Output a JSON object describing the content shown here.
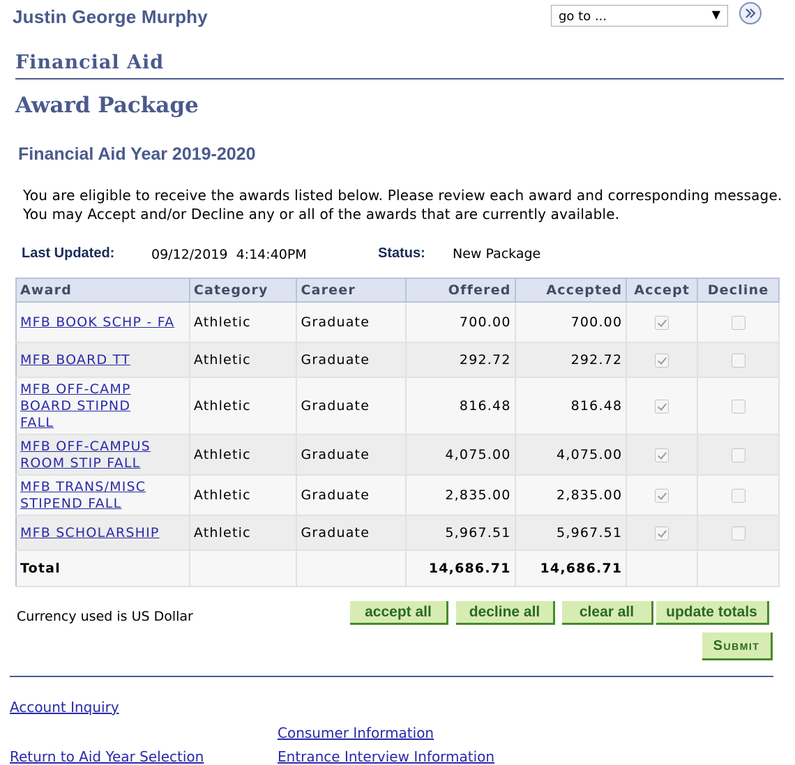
{
  "header": {
    "student_name": "Justin George Murphy",
    "goto": {
      "selected": "go to ..."
    }
  },
  "section_title": "Financial Aid",
  "page_title": "Award Package",
  "aid_year_heading": "Financial Aid Year 2019-2020",
  "intro": "You are eligible to receive the awards listed below. Please review each award and corresponding message. You may Accept and/or Decline any or all of the awards that are currently available.",
  "meta": {
    "last_updated_label": "Last Updated:",
    "last_updated_value": "09/12/2019  4:14:40PM",
    "status_label": "Status:",
    "status_value": "New Package"
  },
  "table": {
    "headers": [
      "Award",
      "Category",
      "Career",
      "Offered",
      "Accepted",
      "Accept",
      "Decline"
    ],
    "rows": [
      {
        "award": "MFB BOOK SCHP - FA",
        "category": "Athletic",
        "career": "Graduate",
        "offered": "700.00",
        "accepted": "700.00",
        "accept_checked": true,
        "decline_checked": false
      },
      {
        "award": "MFB BOARD TT",
        "category": "Athletic",
        "career": "Graduate",
        "offered": "292.72",
        "accepted": "292.72",
        "accept_checked": true,
        "decline_checked": false
      },
      {
        "award": "MFB OFF-CAMP BOARD STIPND FALL",
        "category": "Athletic",
        "career": "Graduate",
        "offered": "816.48",
        "accepted": "816.48",
        "accept_checked": true,
        "decline_checked": false
      },
      {
        "award": "MFB OFF-CAMPUS ROOM STIP FALL",
        "category": "Athletic",
        "career": "Graduate",
        "offered": "4,075.00",
        "accepted": "4,075.00",
        "accept_checked": true,
        "decline_checked": false
      },
      {
        "award": "MFB TRANS/MISC STIPEND FALL",
        "category": "Athletic",
        "career": "Graduate",
        "offered": "2,835.00",
        "accepted": "2,835.00",
        "accept_checked": true,
        "decline_checked": false
      },
      {
        "award": "MFB SCHOLARSHIP",
        "category": "Athletic",
        "career": "Graduate",
        "offered": "5,967.51",
        "accepted": "5,967.51",
        "accept_checked": true,
        "decline_checked": false
      }
    ],
    "total": {
      "label": "Total",
      "offered": "14,686.71",
      "accepted": "14,686.71"
    }
  },
  "currency_note": "Currency used is US Dollar",
  "buttons": {
    "accept_all": "accept all",
    "decline_all": "decline all",
    "clear_all": "clear all",
    "update_totals": "update totals",
    "submit": "Submit"
  },
  "footer_links": {
    "account_inquiry": "Account Inquiry",
    "consumer_information": "Consumer Information",
    "return_to_aid_year": "Return to Aid Year Selection",
    "entrance_interview": "Entrance Interview Information"
  },
  "colors": {
    "heading": "#4a5a8c",
    "link": "#2a2aa8",
    "button_bg": "#d7ecb3",
    "button_text": "#2a6a1f",
    "table_header_bg": "#dde3f0"
  }
}
